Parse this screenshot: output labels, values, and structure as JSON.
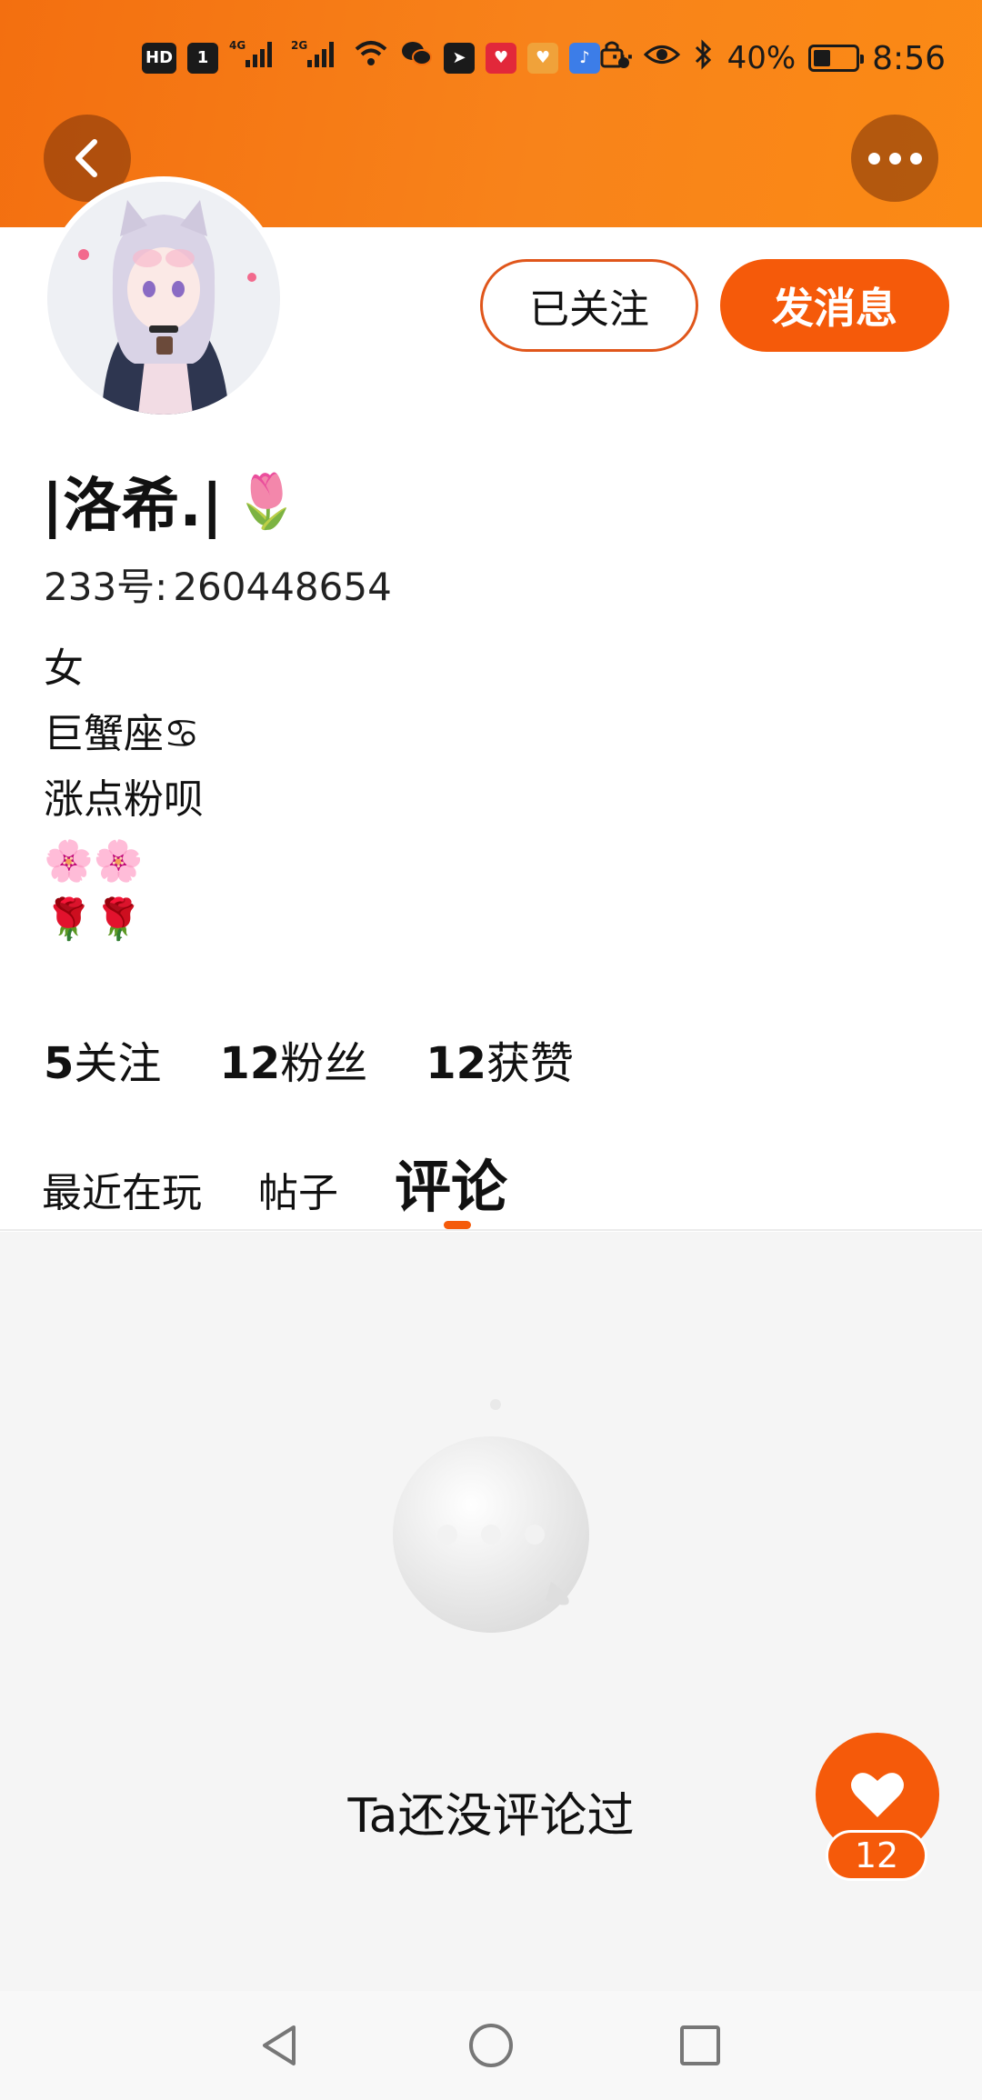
{
  "status_bar": {
    "hd_badge": "HD",
    "sim_badge": "1",
    "network_1": "4G",
    "network_2": "2G",
    "more_dots": "···",
    "battery_percent": "40%",
    "time": "8:56"
  },
  "header": {
    "back_icon": "chevron-left-icon",
    "more_icon": "more-dots-icon"
  },
  "profile": {
    "follow_label": "已关注",
    "message_label": "发消息",
    "username": "|洛希.|",
    "username_emoji": "🌷",
    "id_label": "233号:",
    "id_value": "260448654",
    "bio": [
      "女",
      "巨蟹座♋",
      "涨点粉呗",
      "🌸🌸",
      "🌹🌹"
    ]
  },
  "stats": {
    "following_count": "5",
    "following_label": "关注",
    "followers_count": "12",
    "followers_label": "粉丝",
    "likes_count": "12",
    "likes_label": "获赞"
  },
  "tabs": [
    "最近在玩",
    "帖子",
    "评论"
  ],
  "active_tab_index": 2,
  "empty_state": {
    "icon": "chat-bubble-icon",
    "text": "Ta还没评论过"
  },
  "like_fab": {
    "icon": "heart-icon",
    "count": "12"
  },
  "nav": {
    "back_icon": "nav-back-icon",
    "home_icon": "nav-home-icon",
    "recents_icon": "nav-recents-icon"
  },
  "colors": {
    "brand_orange": "#f55a0a",
    "header_gradient_start": "#f36f10",
    "header_gradient_end": "#fb8a15"
  }
}
